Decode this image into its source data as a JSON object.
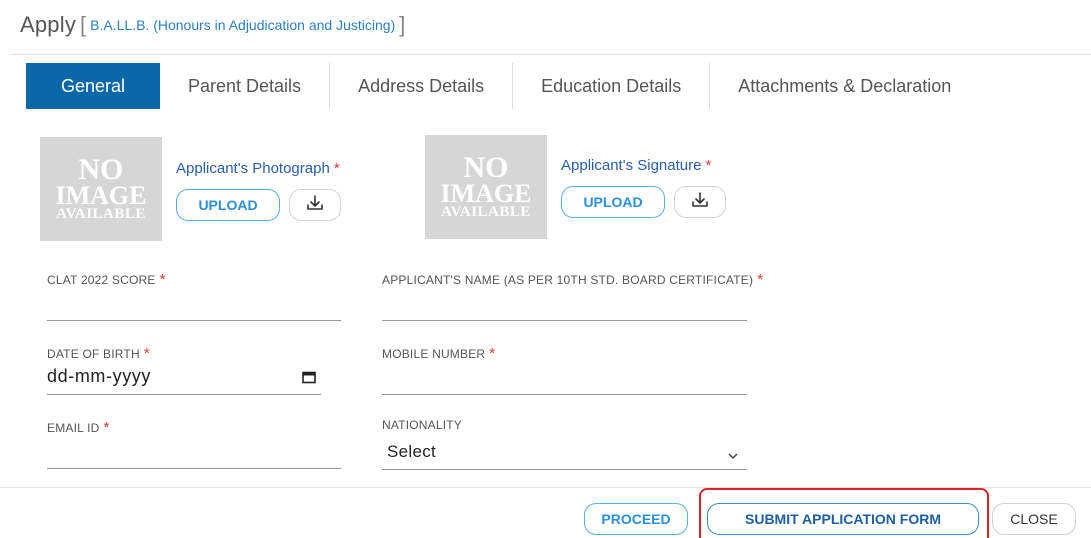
{
  "header": {
    "title": "Apply",
    "bracket_open": "[",
    "course": "B.A.LL.B. (Honours in Adjudication and Justicing)",
    "bracket_close": "]"
  },
  "tabs": [
    {
      "label": "General",
      "active": true
    },
    {
      "label": "Parent Details",
      "active": false
    },
    {
      "label": "Address Details",
      "active": false
    },
    {
      "label": "Education Details",
      "active": false
    },
    {
      "label": "Attachments & Declaration",
      "active": false
    }
  ],
  "placeholder_image": {
    "line1": "NO",
    "line2": "IMAGE",
    "line3": "AVAILABLE"
  },
  "uploads": {
    "photograph": {
      "label": "Applicant's Photograph",
      "required_mark": "*",
      "upload_label": "UPLOAD",
      "icon": "download-icon"
    },
    "signature": {
      "label": "Applicant's Signature",
      "required_mark": "*",
      "upload_label": "UPLOAD",
      "icon": "download-icon"
    }
  },
  "fields": {
    "clat_score": {
      "label": "CLAT 2022 SCORE",
      "required_mark": "*",
      "value": ""
    },
    "applicant_name": {
      "label": "APPLICANT'S NAME (AS PER 10TH STD. BOARD CERTIFICATE)",
      "required_mark": "*",
      "value": ""
    },
    "date_of_birth": {
      "label": "DATE OF BIRTH",
      "required_mark": "*",
      "placeholder": "dd-mm-yyyy",
      "icon": "calendar-icon"
    },
    "mobile_number": {
      "label": "MOBILE NUMBER",
      "required_mark": "*",
      "value": ""
    },
    "email_id": {
      "label": "EMAIL ID",
      "required_mark": "*",
      "value": ""
    },
    "nationality": {
      "label": "NATIONALITY",
      "selected": "Select",
      "icon": "chevron-down-icon"
    }
  },
  "footer": {
    "proceed_label": "PROCEED",
    "submit_label": "SUBMIT APPLICATION FORM",
    "close_label": "CLOSE"
  },
  "colors": {
    "active_tab": "#0a68a8",
    "link_blue": "#2d7fc1",
    "required_red": "#e53935",
    "highlight_red": "#d9232e"
  }
}
